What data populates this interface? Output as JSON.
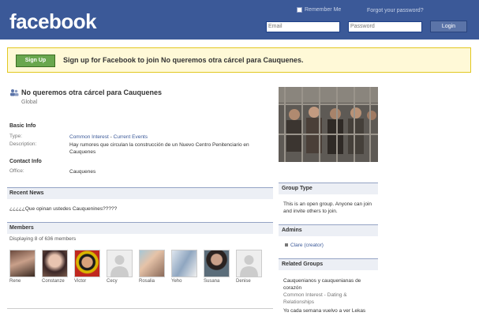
{
  "header": {
    "logo": "facebook",
    "remember_label": "Remember Me",
    "forgot_label": "Forgot your password?",
    "email_placeholder": "Email",
    "password_placeholder": "Password",
    "login_label": "Login"
  },
  "banner": {
    "signup_label": "Sign Up",
    "text": "Sign up for Facebook to join No queremos otra cárcel para Cauquenes."
  },
  "group": {
    "title": "No queremos otra cárcel para Cauquenes",
    "subtitle": "Global",
    "basic_info_label": "Basic Info",
    "type_label": "Type:",
    "type_value_1": "Common Interest",
    "type_sep": " - ",
    "type_value_2": "Current Events",
    "description_label": "Description:",
    "description_value": "Hay rumores que circulan la construcción de un Nuevo Centro Penitenciario en Cauquenes",
    "contact_label": "Contact Info",
    "office_label": "Office:",
    "office_value": "Cauquenes"
  },
  "recent_news": {
    "label": "Recent News",
    "text": "¿¿¿¿¿Que opinan ustedes Cauquenines?????"
  },
  "members": {
    "label": "Members",
    "count_text": "Displaying 8 of 636 members",
    "list": [
      {
        "name": "Rene"
      },
      {
        "name": "Constanze"
      },
      {
        "name": "Victor"
      },
      {
        "name": "Cecy"
      },
      {
        "name": "Rosalia"
      },
      {
        "name": "Yeho"
      },
      {
        "name": "Susana"
      },
      {
        "name": "Denise"
      }
    ]
  },
  "sidebar": {
    "group_type_label": "Group Type",
    "group_type_text": "This is an open group. Anyone can join and invite others to join.",
    "admins_label": "Admins",
    "admin_name": "Clare (creator)",
    "related_label": "Related Groups",
    "related_1": "Cauquenianos y cauquenianas de corazón",
    "related_1_sub": "Common Interest - Dating & Relationships",
    "related_2": "Yo cada semana vuelvo a ver Lekas"
  },
  "colors": {
    "brand": "#3b5998",
    "banner_bg": "#fff9d7",
    "signup": "#69a74e"
  }
}
